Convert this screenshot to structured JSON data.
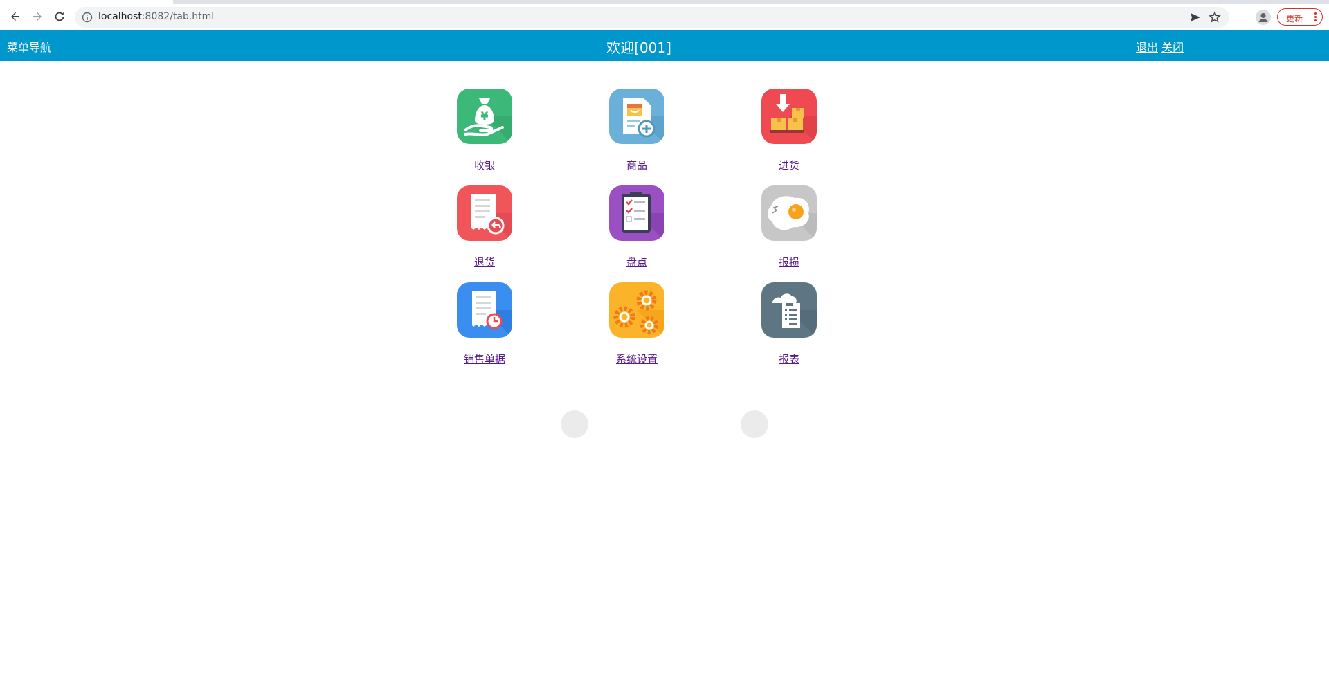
{
  "browser": {
    "url_host": "localhost",
    "url_path": ":8082/tab.html",
    "update_label": "更新"
  },
  "header": {
    "nav_title": "菜单导航",
    "welcome": "欢迎[001]",
    "logout": "退出",
    "close": "关闭",
    "color": "#0097cc"
  },
  "tiles": [
    {
      "label": "收银",
      "icon": "money-bag-hand-icon",
      "color": "#3cb878"
    },
    {
      "label": "商品",
      "icon": "product-add-icon",
      "color": "#6ab0d8"
    },
    {
      "label": "进货",
      "icon": "stock-in-boxes-icon",
      "color": "#ef4a52"
    },
    {
      "label": "退货",
      "icon": "return-receipt-icon",
      "color": "#f0555a"
    },
    {
      "label": "盘点",
      "icon": "inventory-clipboard-icon",
      "color": "#9a4fc2"
    },
    {
      "label": "报损",
      "icon": "broken-egg-icon",
      "color": "#c7c7c7"
    },
    {
      "label": "销售单据",
      "icon": "sales-receipt-clock-icon",
      "color": "#3a8ef0"
    },
    {
      "label": "系统设置",
      "icon": "gears-icon",
      "color": "#fbb32a"
    },
    {
      "label": "报表",
      "icon": "report-cloud-icon",
      "color": "#5e7684"
    }
  ]
}
